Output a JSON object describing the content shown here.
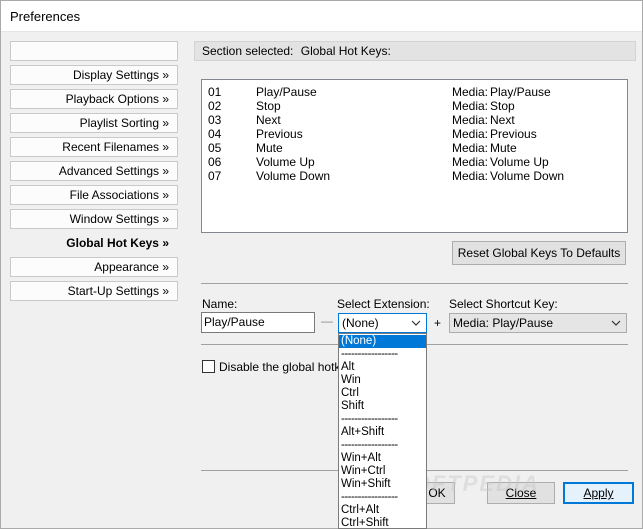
{
  "window": {
    "title": "Preferences"
  },
  "sidebar": {
    "items": [
      {
        "label": ""
      },
      {
        "label": "Display Settings »"
      },
      {
        "label": "Playback Options »"
      },
      {
        "label": "Playlist Sorting »"
      },
      {
        "label": "Recent Filenames »"
      },
      {
        "label": "Advanced Settings »"
      },
      {
        "label": "File Associations »"
      },
      {
        "label": "Window Settings »"
      },
      {
        "label": "Global Hot Keys »"
      },
      {
        "label": "Appearance »"
      },
      {
        "label": "Start-Up Settings »"
      }
    ]
  },
  "section": {
    "label": "Section selected:",
    "value": "Global Hot Keys:"
  },
  "hotkeys": [
    {
      "num": "01",
      "name": "Play/Pause",
      "media": "Media:",
      "action": "Play/Pause"
    },
    {
      "num": "02",
      "name": "Stop",
      "media": "Media:",
      "action": "Stop"
    },
    {
      "num": "03",
      "name": "Next",
      "media": "Media:",
      "action": "Next"
    },
    {
      "num": "04",
      "name": "Previous",
      "media": "Media:",
      "action": "Previous"
    },
    {
      "num": "05",
      "name": "Mute",
      "media": "Media:",
      "action": "Mute"
    },
    {
      "num": "06",
      "name": "Volume Up",
      "media": "Media:",
      "action": "Volume Up"
    },
    {
      "num": "07",
      "name": "Volume Down",
      "media": "Media:",
      "action": "Volume Down"
    }
  ],
  "reset_button": "Reset Global Keys To Defaults",
  "form": {
    "name_label": "Name:",
    "name_value": "Play/Pause",
    "dash": "—",
    "extension_label": "Select Extension:",
    "extension_value": "(None)",
    "plus": "+",
    "shortcut_label": "Select Shortcut Key:",
    "shortcut_value": "Media:  Play/Pause"
  },
  "dropdown": {
    "items": [
      "(None)",
      "-----------------",
      "Alt",
      "Win",
      "Ctrl",
      "Shift",
      "-----------------",
      "Alt+Shift",
      "-----------------",
      "Win+Alt",
      "Win+Ctrl",
      "Win+Shift",
      "-----------------",
      "Ctrl+Alt",
      "Ctrl+Shift"
    ]
  },
  "checkbox": {
    "label": "Disable the global hotkeys"
  },
  "buttons": {
    "ok": "OK",
    "close": "Close",
    "apply": "Apply"
  },
  "watermark": "SOFTPEDIA"
}
